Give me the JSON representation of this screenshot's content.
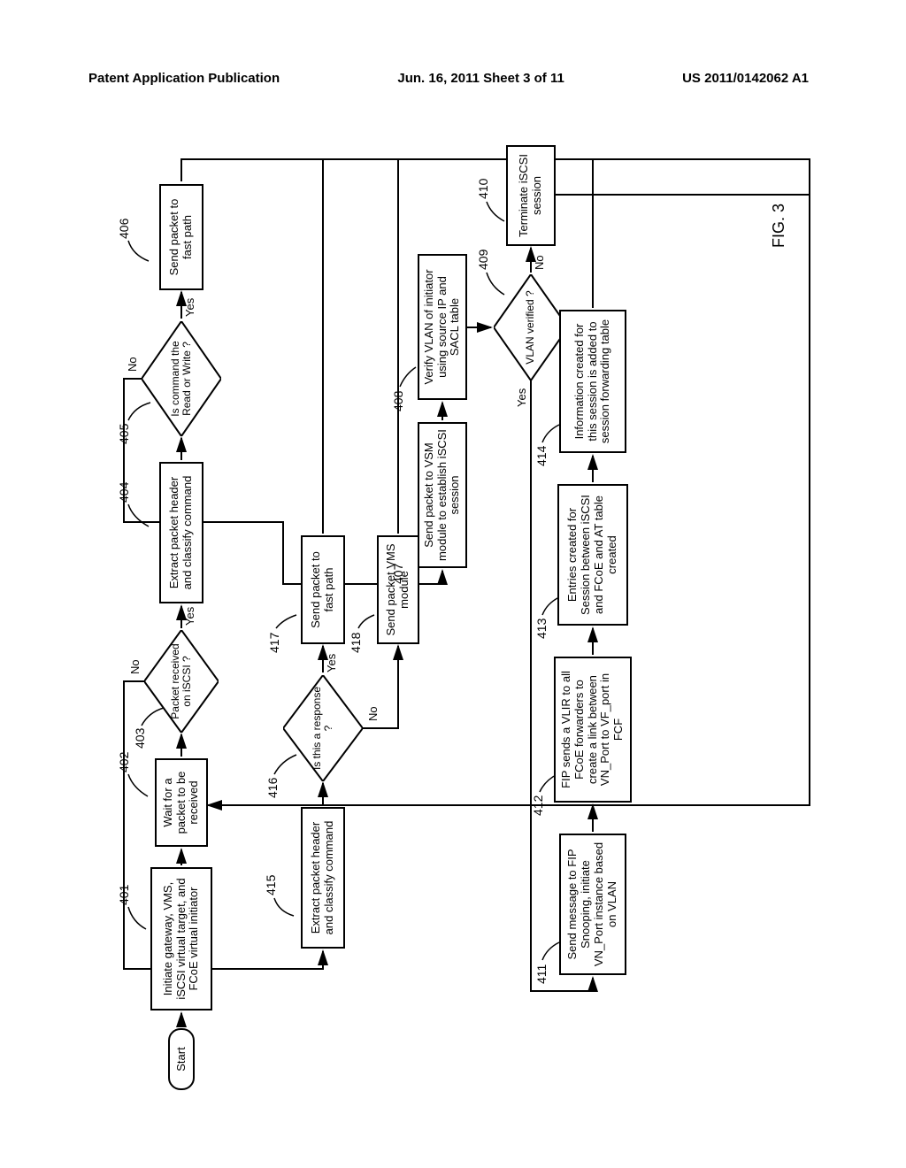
{
  "header": {
    "left": "Patent Application Publication",
    "center": "Jun. 16, 2011  Sheet 3 of 11",
    "right": "US 2011/0142062 A1"
  },
  "figlabel": "FIG. 3",
  "nums": {
    "n401": "401",
    "n402": "402",
    "n403": "403",
    "n404": "404",
    "n405": "405",
    "n406": "406",
    "n407": "407",
    "n408": "408",
    "n409": "409",
    "n410": "410",
    "n411": "411",
    "n412": "412",
    "n413": "413",
    "n414": "414",
    "n415": "415",
    "n416": "416",
    "n417": "417",
    "n418": "418"
  },
  "yn": {
    "yes": "Yes",
    "no": "No"
  },
  "labels": {
    "start": "Start",
    "b401": "Initiate gateway, VMS, iSCSI virtual target, and FCoE virtual initiator",
    "b402": "Wait for a packet to be received",
    "d403": "Packet received on iSCSI ?",
    "b404": "Extract packet header and classify command",
    "d405": "Is command the Read or Write ?",
    "b406": "Send packet to fast path",
    "b407": "Send packet to VSM module to establish iSCSI session",
    "b408": "Verify VLAN of initiator using source IP and SACL table",
    "d409": "VLAN verified ?",
    "b410": "Terminate iSCSI session",
    "b411": "Send message to FIP Snooping, initiate VN_Port instance based on VLAN",
    "b412": "FIP sends a VLIR to all FCoE forwarders to create a link between VN_Port to VF_port in FCF",
    "b413": "Entries created for Session between iSCSI and FCoE and AT table created",
    "b414": "Information created for this session is added to session forwarding table",
    "b415": "Extract packet header and classify command",
    "d416": "Is this a response ?",
    "b417": "Send packet to fast path",
    "b418": "Send packet VMS module"
  }
}
